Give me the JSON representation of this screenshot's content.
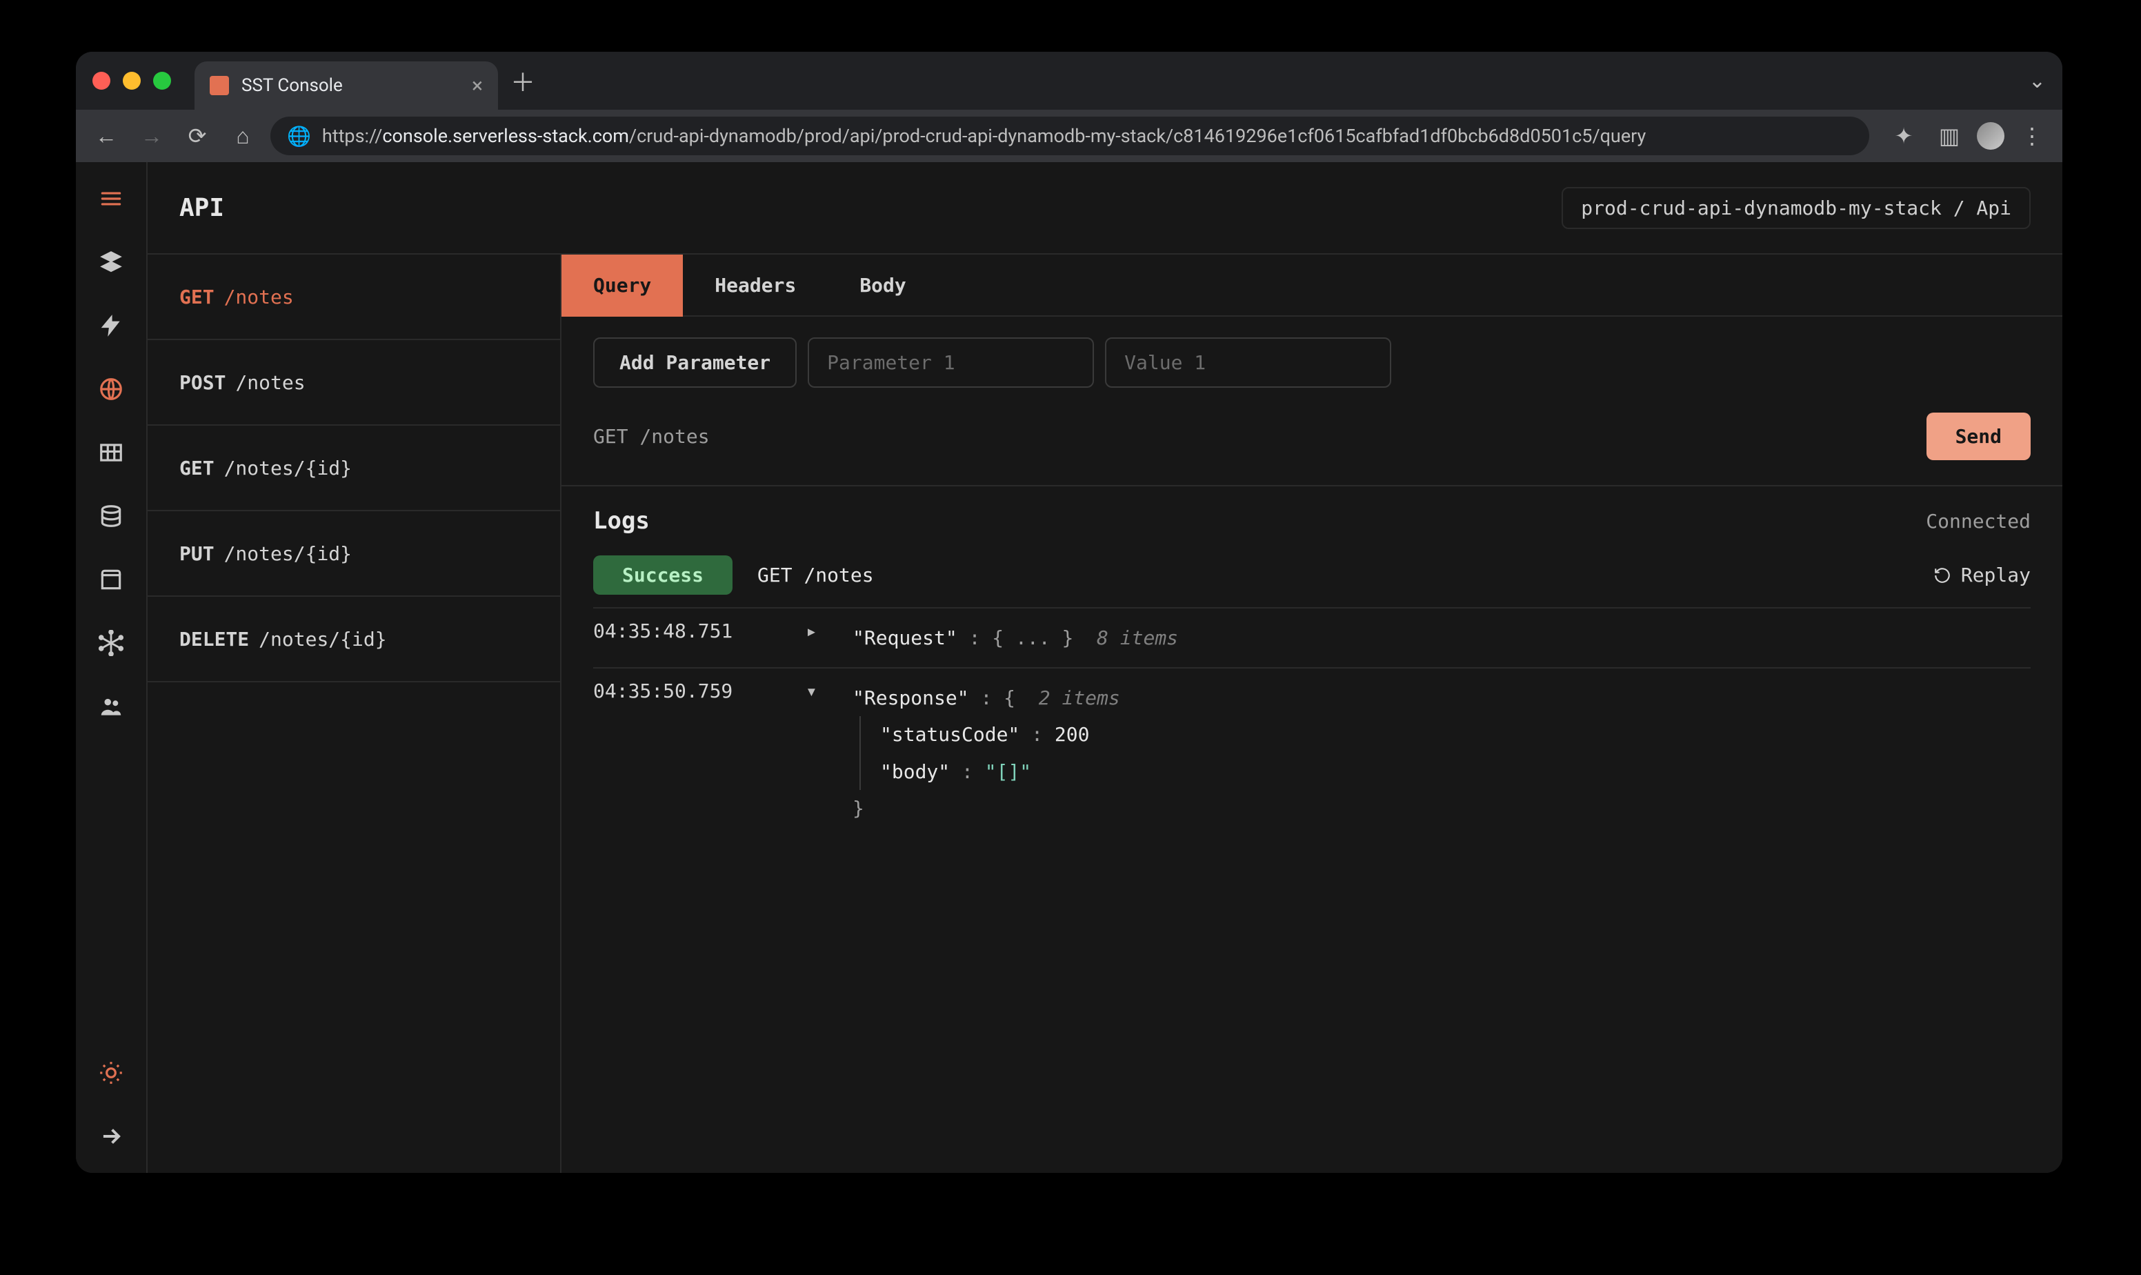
{
  "browser": {
    "tab_title": "SST Console",
    "url_prefix": "https://",
    "url_host": "console.serverless-stack.com",
    "url_path": "/crud-api-dynamodb/prod/api/prod-crud-api-dynamodb-my-stack/c814619296e1cf0615cafbfad1df0bcb6d8d0501c5/query"
  },
  "header": {
    "title": "API",
    "stack_path": "prod-crud-api-dynamodb-my-stack / Api"
  },
  "rail_icons": [
    "logo",
    "stacks",
    "functions",
    "api",
    "tables",
    "rds",
    "buckets",
    "graphql",
    "cognito"
  ],
  "bottom_icons": [
    "theme",
    "collapse"
  ],
  "routes": [
    {
      "method": "GET",
      "path": "/notes",
      "active": true
    },
    {
      "method": "POST",
      "path": "/notes"
    },
    {
      "method": "GET",
      "path": "/notes/{id}"
    },
    {
      "method": "PUT",
      "path": "/notes/{id}"
    },
    {
      "method": "DELETE",
      "path": "/notes/{id}"
    }
  ],
  "tabs": {
    "items": [
      "Query",
      "Headers",
      "Body"
    ],
    "active": "Query"
  },
  "param_row": {
    "add_label": "Add Parameter",
    "name_placeholder": "Parameter 1",
    "value_placeholder": "Value 1"
  },
  "request_line": "GET /notes",
  "send_label": "Send",
  "logs": {
    "title": "Logs",
    "status": "Connected",
    "entry": {
      "badge": "Success",
      "label": "GET /notes",
      "replay_label": "Replay"
    },
    "rows": [
      {
        "ts": "04:35:48.751",
        "expanded": false,
        "key": "\"Request\"",
        "items_count": "8 items"
      },
      {
        "ts": "04:35:50.759",
        "expanded": true,
        "key": "\"Response\"",
        "items_count": "2 items",
        "children": [
          {
            "key": "\"statusCode\"",
            "value": "200",
            "type": "num"
          },
          {
            "key": "\"body\"",
            "value": "\"[]\"",
            "type": "str"
          }
        ]
      }
    ]
  }
}
